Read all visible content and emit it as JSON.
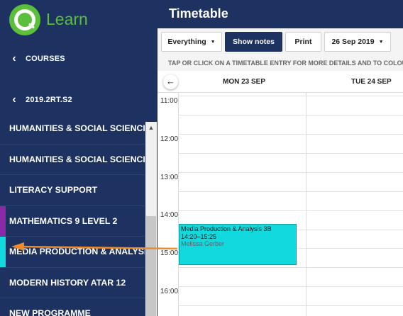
{
  "brand": {
    "name": "Learn",
    "logo_icon": "learn-logo-icon"
  },
  "nav": {
    "back1_label": "COURSES",
    "back2_label": "2019.2RT.S2"
  },
  "courses": [
    {
      "name": "HUMANITIES & SOCIAL SCIENCE",
      "color": "#1d3260"
    },
    {
      "name": "HUMANITIES & SOCIAL SCIENCE",
      "color": "#1d3260"
    },
    {
      "name": "LITERACY SUPPORT",
      "color": "#1d3260"
    },
    {
      "name": "MATHEMATICS 9 LEVEL 2",
      "color": "#8a2aa8"
    },
    {
      "name": "MEDIA PRODUCTION & ANALYSIS",
      "color": "#12d9dd"
    },
    {
      "name": "MODERN HISTORY ATAR 12",
      "color": "#1d3260"
    },
    {
      "name": "NEW PROGRAMME",
      "color": "#1d3260"
    }
  ],
  "header": {
    "title": "Timetable"
  },
  "toolbar": {
    "filter_label": "Everything",
    "notes_label": "Show notes",
    "print_label": "Print",
    "date_label": "26 Sep 2019"
  },
  "hint": "TAP OR CLICK ON A TIMETABLE ENTRY FOR MORE DETAILS AND TO COLOUR",
  "days": [
    "MON 23 SEP",
    "TUE 24 SEP"
  ],
  "times": [
    "11:00",
    "12:00",
    "13:00",
    "14:00",
    "15:00",
    "16:00"
  ],
  "event": {
    "title": "Media Production & Analysis 3B",
    "time": "14:20–15:25",
    "teacher": "Melissa Gerber",
    "color": "#12d9dd"
  },
  "annotation": {
    "arrow_color": "#f08a24"
  }
}
